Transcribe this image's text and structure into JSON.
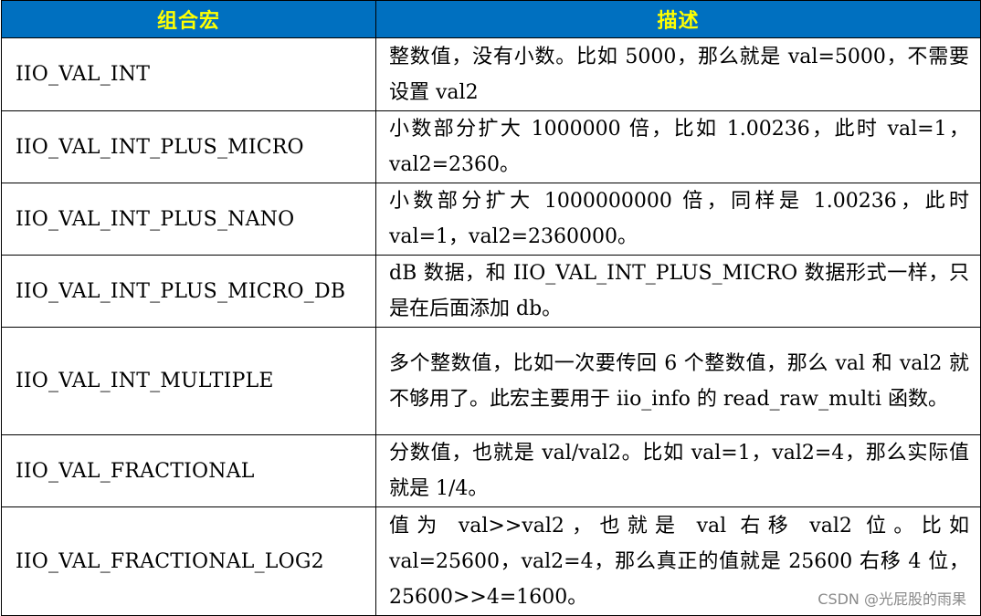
{
  "table": {
    "headers": {
      "name": "组合宏",
      "description": "描述"
    },
    "rows": [
      {
        "name": "IIO_VAL_INT",
        "description": "整数值，没有小数。比如 5000，那么就是 val=5000，不需要设置 val2"
      },
      {
        "name": "IIO_VAL_INT_PLUS_MICRO",
        "description": "小数部分扩大 1000000 倍，比如 1.00236，此时 val=1，val2=2360。"
      },
      {
        "name": "IIO_VAL_INT_PLUS_NANO",
        "description": "小数部分扩大 1000000000 倍，同样是 1.00236，此时 val=1，val2=2360000。"
      },
      {
        "name": "IIO_VAL_INT_PLUS_MICRO_DB",
        "description": "dB 数据，和 IIO_VAL_INT_PLUS_MICRO 数据形式一样，只是在后面添加 db。"
      },
      {
        "name": "IIO_VAL_INT_MULTIPLE",
        "description": "多个整数值，比如一次要传回 6 个整数值，那么 val 和 val2 就不够用了。此宏主要用于 iio_info 的 read_raw_multi 函数。"
      },
      {
        "name": "IIO_VAL_FRACTIONAL",
        "description": "分数值，也就是 val/val2。比如 val=1，val2=4，那么实际值就是 1/4。"
      },
      {
        "name": "IIO_VAL_FRACTIONAL_LOG2",
        "description": "值为 val>>val2，也就是 val 右移 val2 位。比如 val=25600，val2=4，那么真正的值就是 25600 右移 4 位，25600>>4=1600。"
      }
    ]
  },
  "watermark": "CSDN @光屁股的雨果",
  "colors": {
    "header_background": "#0070c0",
    "header_text": "#ffff00",
    "border": "#000000",
    "body_text": "#000000"
  }
}
